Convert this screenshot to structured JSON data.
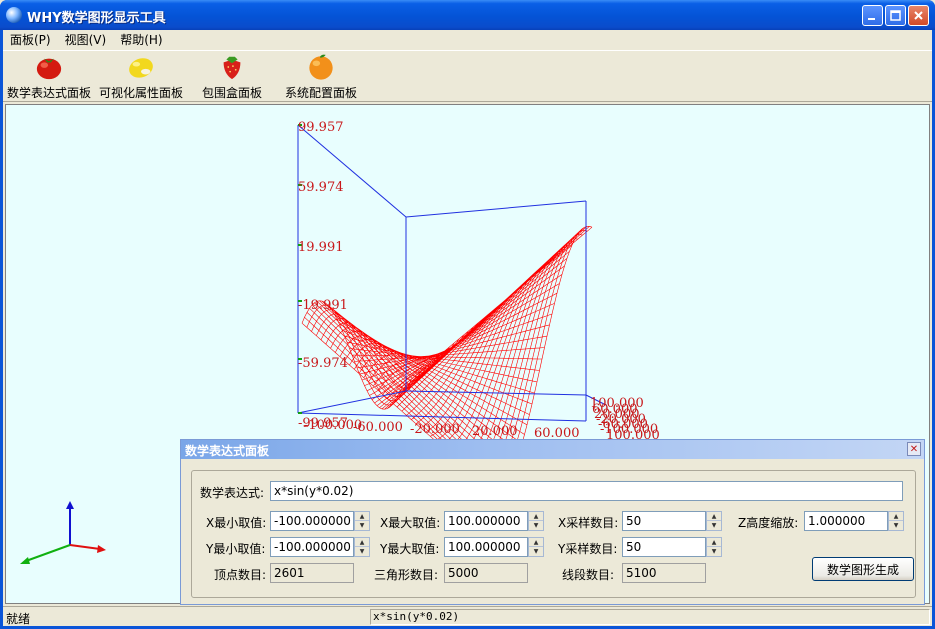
{
  "window": {
    "title": "WHY数学图形显示工具"
  },
  "menu": [
    "面板(P)",
    "视图(V)",
    "帮助(H)"
  ],
  "toolbar": [
    {
      "label": "数学表达式面板",
      "icon": "tomato-icon"
    },
    {
      "label": "可视化属性面板",
      "icon": "lemon-icon"
    },
    {
      "label": "包围盒面板",
      "icon": "strawberry-icon"
    },
    {
      "label": "系统配置面板",
      "icon": "orange-icon"
    }
  ],
  "plot": {
    "z_ticks": [
      "99.957",
      "59.974",
      "19.991",
      "-19.991",
      "-59.974",
      "-99.957"
    ],
    "x_ticks": [
      "-100.000",
      "-60.000",
      "-20.000",
      "20.000",
      "60.000",
      "100.000"
    ],
    "y_ticks": [
      "100.000",
      "60.000",
      "20.000",
      "-20.000",
      "-60.000",
      "-100.000"
    ],
    "surface_color": "#ff0000",
    "box_color": "#2030e0"
  },
  "panel": {
    "title": "数学表达式面板",
    "expression_label": "数学表达式:",
    "expression": "x*sin(y*0.02)",
    "x_min_label": "X最小取值:",
    "x_min": "-100.000000",
    "x_max_label": "X最大取值:",
    "x_max": "100.000000",
    "x_samples_label": "X采样数目:",
    "x_samples": "50",
    "z_scale_label": "Z高度缩放:",
    "z_scale": "1.000000",
    "y_min_label": "Y最小取值:",
    "y_min": "-100.000000",
    "y_max_label": "Y最大取值:",
    "y_max": "100.000000",
    "y_samples_label": "Y采样数目:",
    "y_samples": "50",
    "vertex_label": "顶点数目:",
    "vertex_count": "2601",
    "triangle_label": "三角形数目:",
    "triangle_count": "5000",
    "segment_label": "线段数目:",
    "segment_count": "5100",
    "generate_button": "数学图形生成"
  },
  "status": {
    "left": "就绪",
    "expression": "x*sin(y*0.02)"
  }
}
